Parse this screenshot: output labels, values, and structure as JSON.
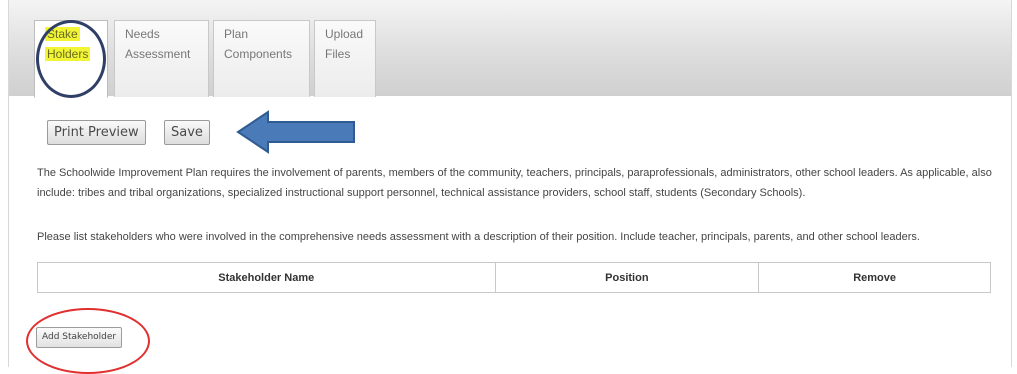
{
  "tabs": [
    {
      "line1": "Stake",
      "line2": "Holders",
      "active": true
    },
    {
      "line1": "Needs",
      "line2": "Assessment",
      "active": false
    },
    {
      "line1": "Plan",
      "line2": "Components",
      "active": false
    },
    {
      "line1": "Upload",
      "line2": "Files",
      "active": false
    }
  ],
  "toolbar": {
    "print_preview_label": "Print Preview",
    "save_label": "Save"
  },
  "content": {
    "intro_paragraph": "The Schoolwide Improvement Plan requires the involvement of parents, members of the community, teachers, principals, paraprofessionals, administrators, other school leaders. As applicable, also include: tribes and tribal organizations, specialized instructional support personnel, technical assistance providers, school staff, students (Secondary Schools).",
    "instruction_paragraph": "Please list stakeholders who were involved in the comprehensive needs assessment with a description of their position. Include teacher, principals, parents, and other school leaders."
  },
  "stakeholder_table": {
    "columns": [
      "Stakeholder Name",
      "Position",
      "Remove"
    ]
  },
  "add_stakeholder_label": "Add Stakeholder",
  "annotations": {
    "highlight_color": "#f1f536",
    "blue_circle_color": "#2f3f66",
    "arrow_color": "#4a7ab8",
    "red_circle_color": "#e03030"
  }
}
